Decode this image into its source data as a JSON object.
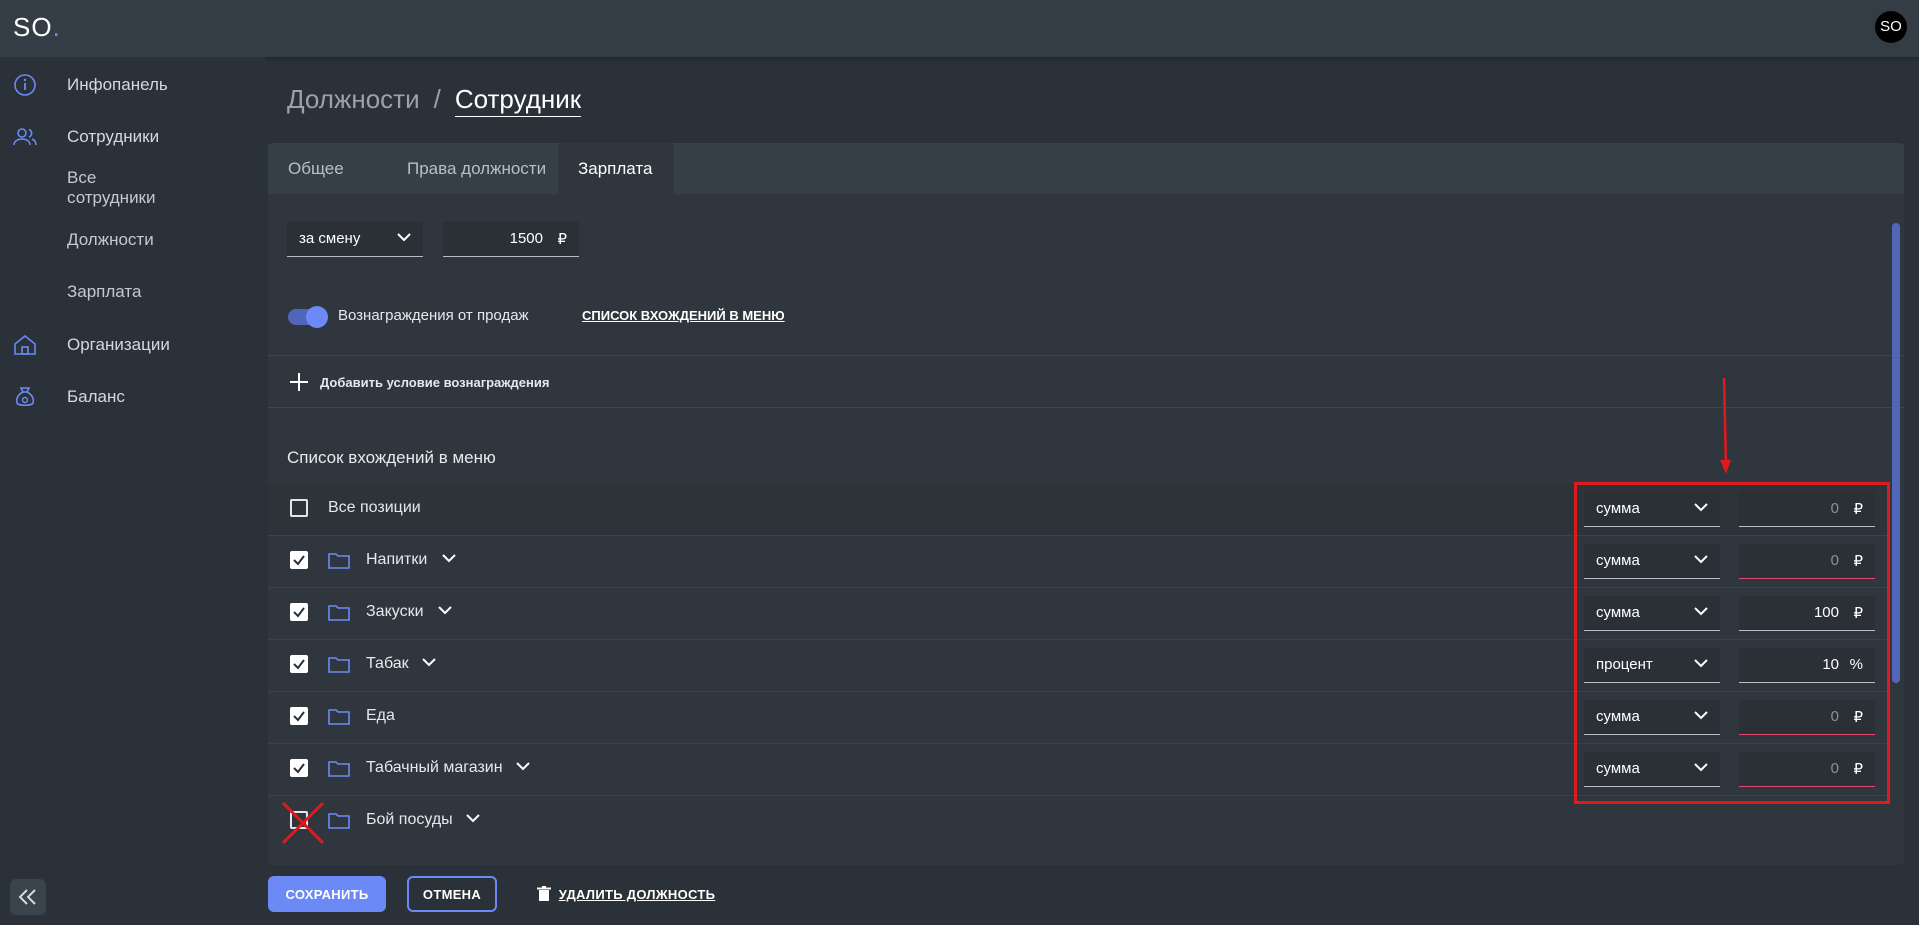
{
  "app": {
    "logo_text": "SO",
    "logo_dot": ".",
    "avatar_text": "SO"
  },
  "sidebar": {
    "dashboard": "Инфопанель",
    "employees": "Сотрудники",
    "sub_all_line1": "Все",
    "sub_all_line2": "сотрудники",
    "sub_positions": "Должности",
    "sub_salary": "Зарплата",
    "organizations": "Организации",
    "balance": "Баланс"
  },
  "breadcrumb": {
    "parent": "Должности",
    "separator": "/",
    "current": "Сотрудник"
  },
  "tabs": [
    "Общее",
    "Права должности",
    "Зарплата"
  ],
  "salary": {
    "period": "за смену",
    "amount": "1500",
    "currency": "₽",
    "rewards_label": "Вознаграждения от продаж",
    "menu_link": "СПИСОК ВХОЖДЕНИЙ В МЕНЮ",
    "add_condition": "Добавить условие вознаграждения",
    "menu_section_title": "Список вхождений в меню"
  },
  "menu_rows": [
    {
      "label": "Все позиции",
      "checked": false,
      "mode": "сумма",
      "value": "0",
      "unit": "₽"
    },
    {
      "label": "Напитки",
      "checked": true,
      "mode": "сумма",
      "value": "0",
      "unit": "₽"
    },
    {
      "label": "Закуски",
      "checked": true,
      "mode": "сумма",
      "value": "100",
      "unit": "₽"
    },
    {
      "label": "Табак",
      "checked": true,
      "mode": "процент",
      "value": "10",
      "unit": "%"
    },
    {
      "label": "Еда",
      "checked": true,
      "mode": "сумма",
      "value": "0",
      "unit": "₽"
    },
    {
      "label": "Табачный магазин",
      "checked": true,
      "mode": "сумма",
      "value": "0",
      "unit": "₽"
    },
    {
      "label": "Бой посуды",
      "checked": false
    }
  ],
  "footer": {
    "save": "СОХРАНИТЬ",
    "cancel": "ОТМЕНА",
    "delete": "УДАЛИТЬ ДОЛЖНОСТЬ"
  },
  "colors": {
    "accent": "#6b8af5",
    "error_underline": "#e24a6b",
    "annotation": "#e0191e"
  }
}
